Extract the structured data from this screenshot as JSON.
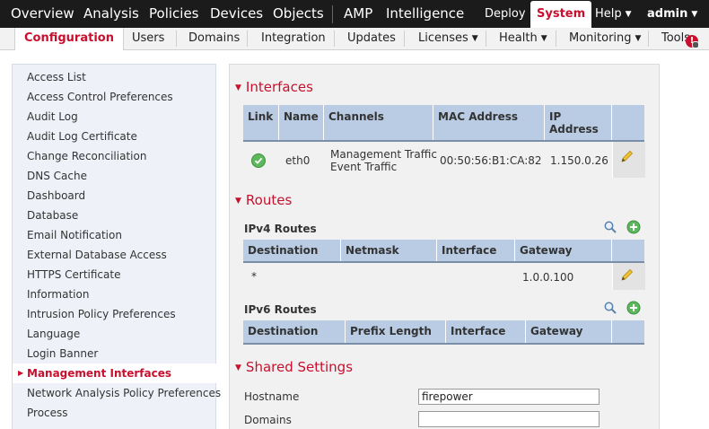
{
  "topnav": {
    "items": [
      "Overview",
      "Analysis",
      "Policies",
      "Devices",
      "Objects",
      "AMP",
      "Intelligence"
    ],
    "deploy": "Deploy",
    "system": "System",
    "help": "Help",
    "user": "admin"
  },
  "subnav": {
    "tabs": [
      "Configuration",
      "Users",
      "Domains",
      "Integration",
      "Updates",
      "Licenses",
      "Health",
      "Monitoring",
      "Tools"
    ]
  },
  "sidebar": {
    "items": [
      "Access List",
      "Access Control Preferences",
      "Audit Log",
      "Audit Log Certificate",
      "Change Reconciliation",
      "DNS Cache",
      "Dashboard",
      "Database",
      "Email Notification",
      "External Database Access",
      "HTTPS Certificate",
      "Information",
      "Intrusion Policy Preferences",
      "Language",
      "Login Banner",
      "Management Interfaces",
      "Network Analysis Policy Preferences",
      "Process"
    ],
    "active_index": 15
  },
  "interfaces": {
    "title": "Interfaces",
    "columns": [
      "Link",
      "Name",
      "Channels",
      "MAC Address",
      "IP Address"
    ],
    "rows": [
      {
        "link_status": "up",
        "name": "eth0",
        "channels": [
          "Management Traffic",
          "Event Traffic"
        ],
        "mac": "00:50:56:B1:CA:82",
        "ip": "1.150.0.26"
      }
    ]
  },
  "routes": {
    "title": "Routes",
    "ipv4": {
      "title": "IPv4 Routes",
      "columns": [
        "Destination",
        "Netmask",
        "Interface",
        "Gateway"
      ],
      "rows": [
        {
          "destination": "*",
          "netmask": "",
          "interface": "",
          "gateway": "1.0.0.100"
        }
      ]
    },
    "ipv6": {
      "title": "IPv6 Routes",
      "columns": [
        "Destination",
        "Prefix Length",
        "Interface",
        "Gateway"
      ],
      "rows": []
    }
  },
  "shared": {
    "title": "Shared Settings",
    "hostname_label": "Hostname",
    "hostname_value": "firepower",
    "domains_label": "Domains",
    "domains_value": ""
  },
  "colors": {
    "accent": "#c8102e",
    "topbar": "#1b1b1b",
    "table_header": "#b9cce4",
    "sidebar_bg": "#eef2f8"
  }
}
